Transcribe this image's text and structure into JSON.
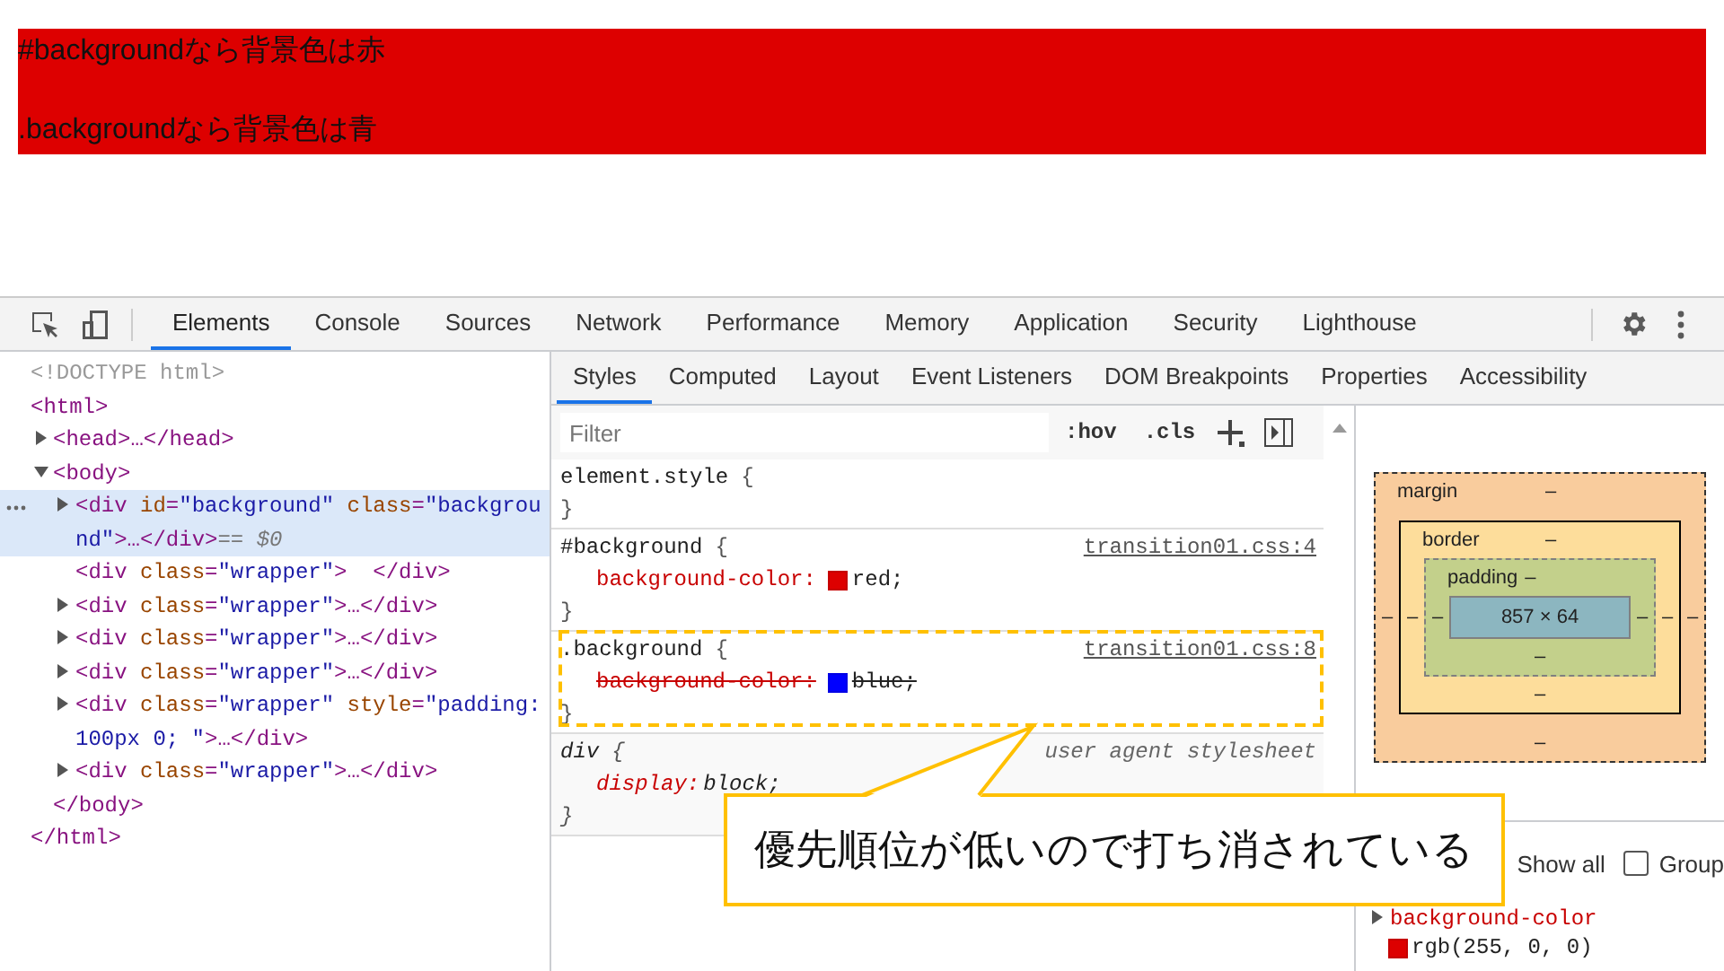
{
  "page": {
    "lines": [
      "#backgroundなら背景色は赤",
      ".backgroundなら背景色は青"
    ]
  },
  "devtools": {
    "main_tabs": [
      {
        "label": "Elements",
        "selected": true
      },
      {
        "label": "Console",
        "selected": false
      },
      {
        "label": "Sources",
        "selected": false
      },
      {
        "label": "Network",
        "selected": false
      },
      {
        "label": "Performance",
        "selected": false
      },
      {
        "label": "Memory",
        "selected": false
      },
      {
        "label": "Application",
        "selected": false
      },
      {
        "label": "Security",
        "selected": false
      },
      {
        "label": "Lighthouse",
        "selected": false
      }
    ],
    "elements": {
      "nodes": [
        {
          "text": "<!DOCTYPE html>",
          "kind": "doctype",
          "selected": false
        },
        {
          "text": "<html>",
          "kind": "element",
          "selected": false,
          "closing": "</html>",
          "children": [
            {
              "text": "<head>…</head>",
              "kind": "element",
              "selected": false,
              "expanded": false
            },
            {
              "text": "<body>",
              "kind": "element",
              "selected": false,
              "expanded": true,
              "closing": "</body>",
              "children": [
                {
                  "text": "<div id=\"background\" class=\"background\">…</div>",
                  "kind": "element",
                  "selected": true,
                  "expanded": false,
                  "console_ref": "== $0"
                },
                {
                  "text": "<div class=\"wrapper\">  </div>",
                  "kind": "element",
                  "selected": false
                },
                {
                  "text": "<div class=\"wrapper\">…</div>",
                  "kind": "element",
                  "selected": false,
                  "expanded": false
                },
                {
                  "text": "<div class=\"wrapper\">…</div>",
                  "kind": "element",
                  "selected": false,
                  "expanded": false
                },
                {
                  "text": "<div class=\"wrapper\">…</div>",
                  "kind": "element",
                  "selected": false,
                  "expanded": false
                },
                {
                  "text": "<div class=\"wrapper\" style=\"padding: 100px 0; \">…</div>",
                  "kind": "element",
                  "selected": false,
                  "expanded": false
                },
                {
                  "text": "<div class=\"wrapper\">…</div>",
                  "kind": "element",
                  "selected": false,
                  "expanded": false
                }
              ]
            }
          ]
        }
      ]
    },
    "styles_tabs": [
      {
        "label": "Styles",
        "selected": true
      },
      {
        "label": "Computed",
        "selected": false
      },
      {
        "label": "Layout",
        "selected": false
      },
      {
        "label": "Event Listeners",
        "selected": false
      },
      {
        "label": "DOM Breakpoints",
        "selected": false
      },
      {
        "label": "Properties",
        "selected": false
      },
      {
        "label": "Accessibility",
        "selected": false
      }
    ],
    "styles": {
      "filter_placeholder": "Filter",
      "tools": [
        ":hov",
        ".cls"
      ],
      "rules": [
        {
          "kind": "inline",
          "selector": "element.style",
          "open": "{",
          "close": "}"
        },
        {
          "kind": "author",
          "selector": "#background",
          "open": "{",
          "close": "}",
          "source": "transition01.css:4",
          "declarations": [
            {
              "property": "background-color:",
              "value": "red;",
              "color": "#dd0000",
              "overridden": false
            }
          ]
        },
        {
          "kind": "author",
          "selector": ".background",
          "open": "{",
          "close": "}",
          "source": "transition01.css:8",
          "declarations": [
            {
              "property": "background-color:",
              "value": "blue;",
              "color": "#0000ff",
              "overridden": true
            }
          ]
        },
        {
          "kind": "user-agent",
          "selector": "div",
          "open": "{",
          "close": "}",
          "source": "user agent stylesheet",
          "declarations": [
            {
              "property": "display:",
              "value": "block;",
              "overridden": false
            }
          ]
        }
      ]
    },
    "box_model": {
      "layers": [
        {
          "label": "margin",
          "top": "–"
        },
        {
          "label": "border",
          "top": "–"
        },
        {
          "label": "padding",
          "top": "–"
        }
      ],
      "left_values": [
        "–",
        "–",
        "–"
      ],
      "right_values": [
        "–",
        "–",
        "–"
      ],
      "bottom_values": [
        "–",
        "–",
        "–"
      ],
      "content": "857 × 64"
    },
    "computed": {
      "show_all_label": "Show all",
      "group": {
        "label": "Group",
        "checked": false
      },
      "properties": [
        {
          "name": "background-color",
          "value": "rgb(255, 0, 0)",
          "color": "#dd0000",
          "expanded": false
        }
      ]
    }
  },
  "callout": {
    "text": "優先順位が低いので打ち消されている"
  }
}
